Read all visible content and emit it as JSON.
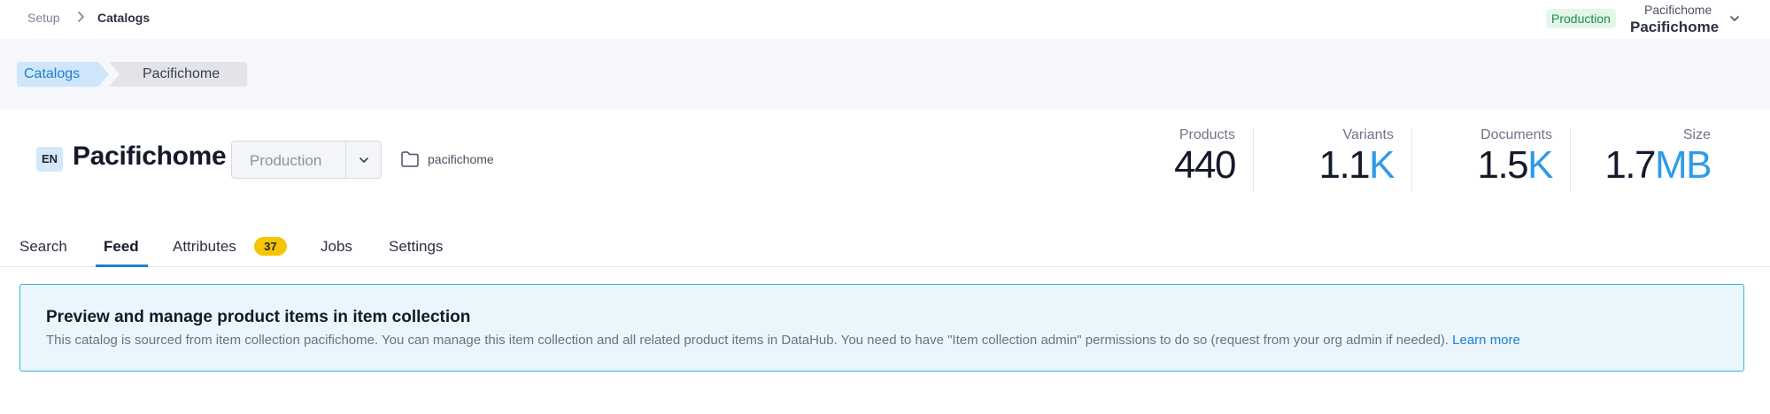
{
  "breadcrumb": {
    "setup": "Setup",
    "current": "Catalogs"
  },
  "environment_badge": "Production",
  "org": {
    "top": "Pacifichome",
    "name": "Pacifichome"
  },
  "pills": {
    "catalogs": "Catalogs",
    "catalog": "Pacifichome"
  },
  "header": {
    "language": "EN",
    "title": "Pacifichome",
    "environment_select": "Production",
    "collection_name": "pacifichome"
  },
  "stats": [
    {
      "label": "Products",
      "value": "440",
      "unit": ""
    },
    {
      "label": "Variants",
      "value": "1.1",
      "unit": "K"
    },
    {
      "label": "Documents",
      "value": "1.5",
      "unit": "K"
    },
    {
      "label": "Size",
      "value": "1.7",
      "unit": "MB"
    }
  ],
  "tabs": [
    {
      "label": "Search"
    },
    {
      "label": "Feed"
    },
    {
      "label": "Attributes",
      "count": "37"
    },
    {
      "label": "Jobs"
    },
    {
      "label": "Settings"
    }
  ],
  "active_tab": "Feed",
  "info": {
    "title": "Preview and manage product items in item collection",
    "text": "This catalog is sourced from item collection pacifichome. You can manage this item collection and all related product items in DataHub. You need to have \"Item collection admin\" permissions to do so (request from your org admin if needed).",
    "link": "Learn more"
  },
  "colors": {
    "accent": "#1b7fd0",
    "unit": "#2f9be6",
    "badge_yellow": "#f6c400",
    "env_green": "#1f8a4c",
    "info_border": "#33b6dd"
  },
  "icons": [
    "chevron-right-icon",
    "chevron-down-icon",
    "folder-icon"
  ]
}
